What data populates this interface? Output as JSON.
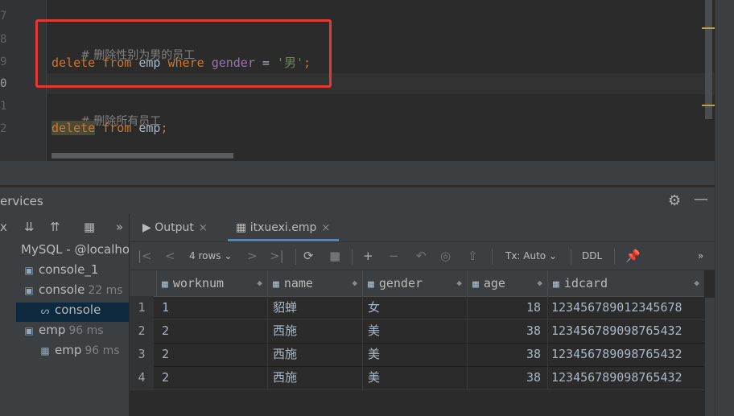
{
  "editor": {
    "line_numbers": [
      "7",
      "8",
      "9",
      "0",
      "1",
      "2"
    ],
    "line1_comment": "# 删除性别为男的员工",
    "line2": {
      "kw1": "delete",
      "kw2": "from",
      "table": "emp",
      "kw3": "where",
      "col": "gender",
      "op": "=",
      "str": "'男'",
      "end": ";"
    },
    "line4_comment": "# 删除所有员工",
    "line5": {
      "kw1": "delete",
      "kw2": "from",
      "table": "emp",
      "end": ";"
    }
  },
  "services": {
    "title": "ervices",
    "tree_items": [
      {
        "label": "MySQL - @localho",
        "meta": ""
      },
      {
        "label": "console_1",
        "meta": ""
      },
      {
        "label": "console",
        "meta": "22 ms"
      },
      {
        "label": "console",
        "meta": ""
      },
      {
        "label": "emp",
        "meta": "96 ms"
      },
      {
        "label": "emp",
        "meta": "96 ms"
      }
    ],
    "more": "»"
  },
  "tabs": [
    {
      "label": "Output",
      "close": "×"
    },
    {
      "label": "itxuexi.emp",
      "close": "×"
    }
  ],
  "result_toolbar": {
    "rows": "4 rows",
    "tx": "Tx: Auto",
    "ddl": "DDL",
    "more": "»"
  },
  "grid": {
    "columns": [
      "worknum",
      "name",
      "gender",
      "age",
      "idcard"
    ],
    "rows": [
      {
        "n": "1",
        "worknum": "1",
        "name": "貂蝉",
        "gender": "女",
        "age": "18",
        "idcard": "123456789012345678"
      },
      {
        "n": "2",
        "worknum": "2",
        "name": "西施",
        "gender": "美",
        "age": "38",
        "idcard": "123456789098765432"
      },
      {
        "n": "3",
        "worknum": "2",
        "name": "西施",
        "gender": "美",
        "age": "38",
        "idcard": "123456789098765432"
      },
      {
        "n": "4",
        "worknum": "2",
        "name": "西施",
        "gender": "美",
        "age": "38",
        "idcard": "123456789098765432"
      }
    ]
  },
  "colors": {
    "accent": "#4a88c7",
    "highlight_box": "#e23a32",
    "keyword": "#cc7832",
    "string": "#6a8759",
    "column": "#9876aa"
  }
}
